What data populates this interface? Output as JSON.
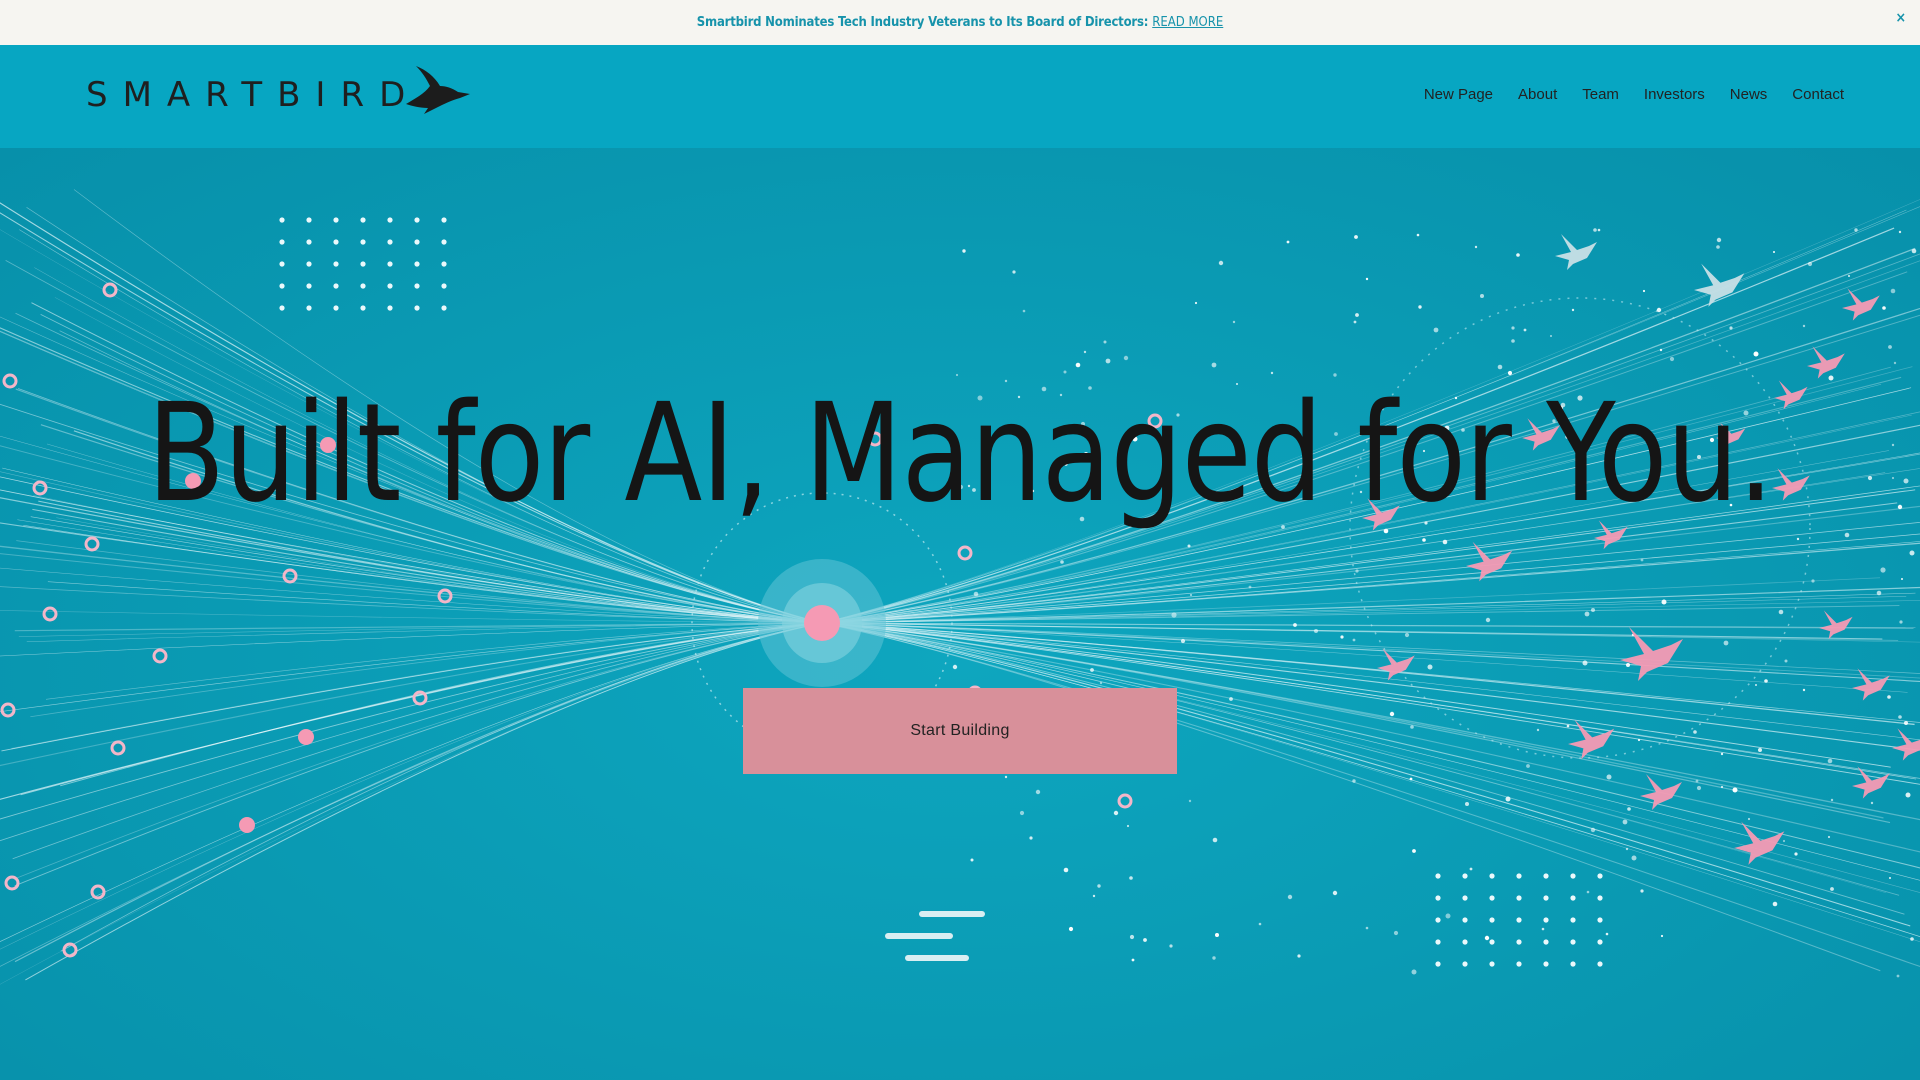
{
  "announcement": {
    "message": "Smartbird Nominates Tech Industry Veterans to Its Board of Directors:",
    "link_label": "READ MORE",
    "close_glyph": "×"
  },
  "header": {
    "logo_text": "SMARTBIRD",
    "logo_icon": "bird-icon",
    "nav": [
      "New Page",
      "About",
      "Team",
      "Investors",
      "News",
      "Contact"
    ]
  },
  "hero": {
    "headline": "Built for AI, Managed for You.",
    "cta_label": "Start Building"
  },
  "colors": {
    "header_bg": "#07a6c2",
    "hero_bg": "#0a9ab3",
    "announcement_bg": "#f6f5f1",
    "link": "#1793ab",
    "accent_pink": "#f59ab4",
    "cta_bg": "#d8909a",
    "text_dark": "#151515"
  }
}
